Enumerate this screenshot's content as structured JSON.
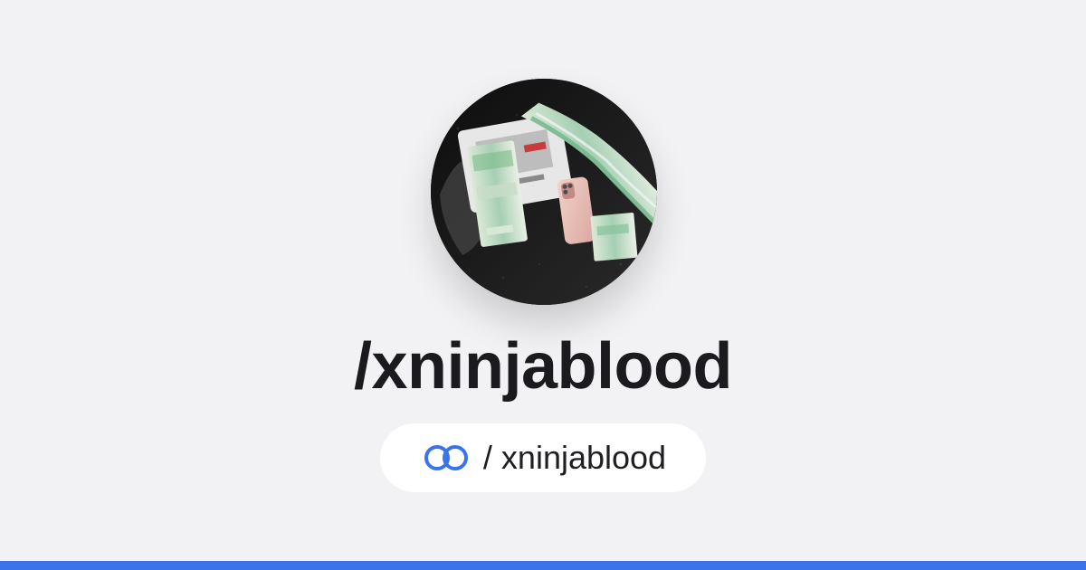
{
  "profile": {
    "title": "/xninjablood",
    "handle": "/ xninjablood"
  },
  "icons": {
    "avatar": "avatar-image",
    "link": "linked-rings-icon"
  },
  "colors": {
    "background": "#f2f2f4",
    "pill_background": "#ffffff",
    "accent": "#3b73ea",
    "text": "#1b1b1f"
  }
}
